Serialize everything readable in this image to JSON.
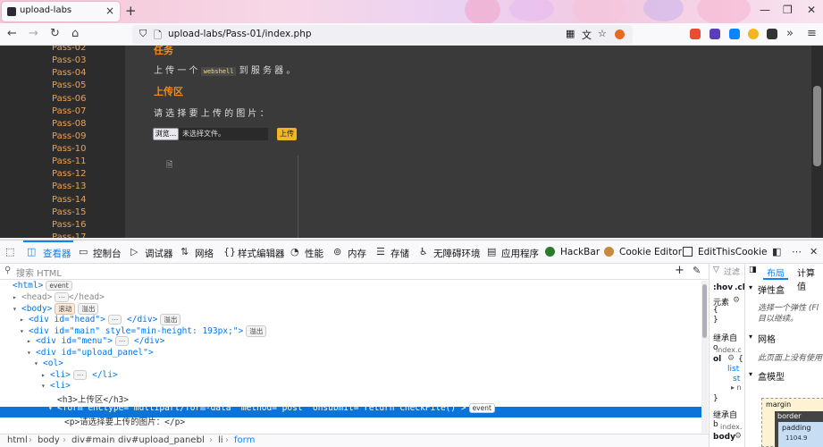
{
  "browser": {
    "tab_title": "upload-labs",
    "url": "upload-labs/Pass-01/index.php"
  },
  "menu": {
    "items": [
      "Pass-02",
      "Pass-03",
      "Pass-04",
      "Pass-05",
      "Pass-06",
      "Pass-07",
      "Pass-08",
      "Pass-09",
      "Pass-10",
      "Pass-11",
      "Pass-12",
      "Pass-13",
      "Pass-14",
      "Pass-15",
      "Pass-16",
      "Pass-17"
    ]
  },
  "main": {
    "task_heading": "任务",
    "task_text_prefix": "上 传 一 个",
    "task_code": "webshell",
    "task_text_suffix": "到 服 务 器 。",
    "upload_heading": "上传区",
    "upload_prompt": "请 选 择 要 上 传 的 图 片 ：",
    "browse_button": "浏览...",
    "file_status": "未选择文件。",
    "upload_button": "上传"
  },
  "devtools": {
    "tabs": [
      "查看器",
      "控制台",
      "调试器",
      "网络",
      "样式编辑器",
      "性能",
      "内存",
      "存储",
      "无障碍环境",
      "应用程序",
      "HackBar",
      "Cookie Editor",
      "EditThisCookie"
    ],
    "search_placeholder": "搜索 HTML",
    "filter_placeholder": "过滤",
    "tree": {
      "html": "<html>",
      "head": "<head>",
      "head_close": "</head>",
      "body": "<body>",
      "div_head": "<div id=\"head\">",
      "div_main": "<div id=\"main\" style=\"min-height: 193px;\">",
      "div_menu": "<div id=\"menu\">",
      "div_upload_panel": "<div id=\"upload_panel\">",
      "ol": "<ol>",
      "li1": "<li>",
      "li2": "<li>",
      "h3": "<h3>上传区</h3>",
      "form": "<form enctype=\"multipart/form-data\" method=\"post\" onsubmit=\"return checkFile()\">",
      "p": "<p>请选择要上传的图片：</p>"
    },
    "badges": {
      "event": "event",
      "scroll": "滚动",
      "overflow": "溢出"
    },
    "breadcrumb": [
      "html",
      "body",
      "div#main",
      "div#upload_panel",
      "ol",
      "li",
      "form"
    ],
    "rules": {
      "hov": ":hov",
      "cls": ".cl",
      "element": "元素",
      "inherit1": "继承自 o",
      "source1": "index.c",
      "ol": "ol",
      "list": "list",
      "st": "st",
      "inherit2": "继承自 b",
      "source2": "index.",
      "body": "body"
    },
    "layout": {
      "tab_layout": "布局",
      "tab_computed": "计算值",
      "flexbox": "弹性盒",
      "flex_desc": "选择一个弹性 (Fl",
      "flex_desc2": "目以继续。",
      "grid": "网格",
      "grid_desc": "此页面上没有使用",
      "boxmodel": "盒模型",
      "margin": "margin",
      "border": "border",
      "padding": "padding",
      "size": "1104.9"
    }
  },
  "colors": {
    "accent": "#0a84ff",
    "menu_link": "#e8a15a",
    "upload_button": "#f3b61f",
    "selection": "#0a74da"
  }
}
